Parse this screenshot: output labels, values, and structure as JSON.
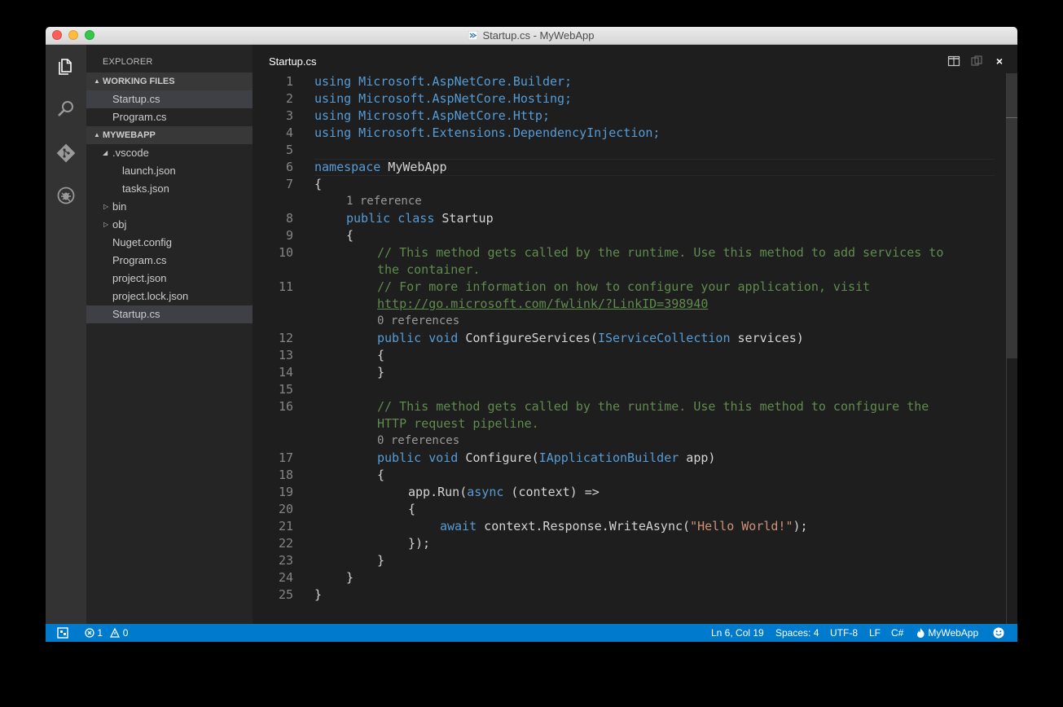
{
  "window": {
    "title": "Startup.cs - MyWebApp"
  },
  "explorer": {
    "title": "EXPLORER",
    "working_files": {
      "header": "WORKING FILES",
      "items": [
        "Startup.cs",
        "Program.cs"
      ]
    },
    "project": {
      "header": "MYWEBAPP",
      "items": [
        {
          "name": ".vscode",
          "kind": "folder",
          "expanded": true
        },
        {
          "name": "launch.json",
          "kind": "file"
        },
        {
          "name": "tasks.json",
          "kind": "file"
        },
        {
          "name": "bin",
          "kind": "folder",
          "expanded": false
        },
        {
          "name": "obj",
          "kind": "folder",
          "expanded": false
        },
        {
          "name": "Nuget.config",
          "kind": "file"
        },
        {
          "name": "Program.cs",
          "kind": "file"
        },
        {
          "name": "project.json",
          "kind": "file"
        },
        {
          "name": "project.lock.json",
          "kind": "file"
        },
        {
          "name": "Startup.cs",
          "kind": "file",
          "selected": true
        }
      ]
    }
  },
  "editor": {
    "tab_title": "Startup.cs",
    "close_glyph": "×",
    "line_numbers": [
      "1",
      "2",
      "3",
      "4",
      "5",
      "6",
      "7",
      "8",
      "9",
      "10",
      "11",
      "12",
      "13",
      "14",
      "15",
      "16",
      "17",
      "18",
      "19",
      "20",
      "21",
      "22",
      "23",
      "24",
      "25"
    ],
    "code": {
      "l1_kw": "using",
      "l1_ns": " Microsoft.AspNetCore.Builder;",
      "l2_kw": "using",
      "l2_ns": " Microsoft.AspNetCore.Hosting;",
      "l3_kw": "using",
      "l3_ns": " Microsoft.AspNetCore.Http;",
      "l4_kw": "using",
      "l4_ns": " Microsoft.Extensions.DependencyInjection;",
      "l6_kw": "namespace",
      "l6_name": " MyWebApp",
      "l7": "{",
      "ref_1": "1 reference",
      "l8_kw1": "public",
      "l8_kw2": "class",
      "l8_name": "Startup",
      "l9": "{",
      "l10a": "// This method gets called by the runtime. Use this method to add services to",
      "l10b": "the container.",
      "l11a": "// For more information on how to configure your application, visit",
      "l11b": "http://go.microsoft.com/fwlink/?LinkID=398940",
      "ref_0a": "0 references",
      "l12_kw1": "public",
      "l12_kw2": "void",
      "l12_name": "ConfigureServices(",
      "l12_type": "IServiceCollection",
      "l12_rest": " services)",
      "l13": "{",
      "l14": "}",
      "l16a": "// This method gets called by the runtime. Use this method to configure the",
      "l16b": "HTTP request pipeline.",
      "ref_0b": "0 references",
      "l17_kw1": "public",
      "l17_kw2": "void",
      "l17_name": "Configure(",
      "l17_type": "IApplicationBuilder",
      "l17_rest": " app)",
      "l18": "{",
      "l19_a": "app.Run(",
      "l19_kw": "async",
      "l19_b": " (context) =>",
      "l20": "{",
      "l21_kw": "await",
      "l21_a": " context.Response.WriteAsync(",
      "l21_str": "\"Hello World!\"",
      "l21_b": ");",
      "l22": "});",
      "l23": "}",
      "l24": "}",
      "l25": "}"
    }
  },
  "statusbar": {
    "errors": "1",
    "warnings": "0",
    "position": "Ln 6, Col 19",
    "spaces": "Spaces: 4",
    "encoding": "UTF-8",
    "eol": "LF",
    "language": "C#",
    "project": "MyWebApp"
  },
  "colors": {
    "statusbar": "#007acc",
    "keyword": "#569cd6",
    "comment": "#608b4e",
    "string": "#ce9178"
  }
}
